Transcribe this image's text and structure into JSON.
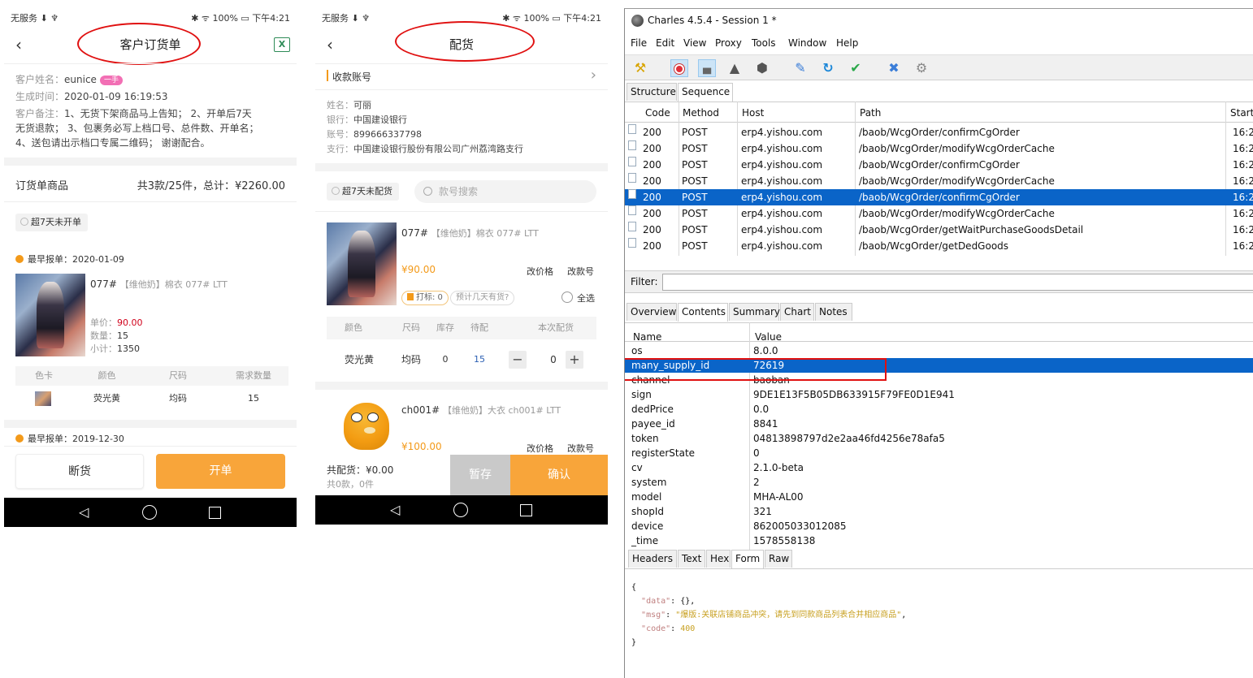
{
  "status": {
    "left": "无服务",
    "battery": "100%",
    "time": "下午4:21"
  },
  "colors": {
    "accent": "#f8a53a",
    "selection": "#0a64c8",
    "annotation": "#e01010"
  },
  "order_page": {
    "title": "客户订货单",
    "customer_label": "客户姓名：",
    "customer_name": "eunice",
    "customer_badge": "一手",
    "time_label": "生成时间：",
    "created_time": "2020-01-09 16:19:53",
    "remark_label": "客户备注：",
    "remark_line1": "1、无货下架商品马上告知； 2、开单后7天",
    "remark_line2": "无货退款； 3、包裹务必写上档口号、总件数、开单名；",
    "remark_line3": "4、送包请出示档口专属二维码； 谢谢配合。",
    "goods_label": "订货单商品",
    "goods_summary": "共3款/25件，总计：¥2260.00",
    "filter_chip": "超7天未开单",
    "earliest_label": "最早报单：",
    "group1_date": "2020-01-09",
    "product": {
      "code": "077#",
      "desc": "【维他奶】棉衣 077# LTT",
      "price_label": "单价：",
      "price": "90.00",
      "qty_label": "数量：",
      "qty": "15",
      "subtotal_label": "小计：",
      "subtotal": "1350"
    },
    "table_headers": [
      "色卡",
      "颜色",
      "尺码",
      "需求数量"
    ],
    "table_row": {
      "color": "荧光黄",
      "size": "均码",
      "qty": "15"
    },
    "group2_date": "2019-12-30",
    "btn_stock_out": "断货",
    "btn_open": "开单"
  },
  "supply_page": {
    "title": "配货",
    "account_label": "收款账号",
    "name_label": "姓名：",
    "name": "可丽",
    "bank_label": "银行：",
    "bank": "中国建设银行",
    "account_no_label": "账号：",
    "account_no": "899666337798",
    "branch_label": "支行：",
    "branch": "中国建设银行股份有限公司广州荔湾路支行",
    "filter_chip": "超7天未配货",
    "search_placeholder": "款号搜索",
    "item1": {
      "code": "077#",
      "desc": "【维他奶】棉衣 077# LTT",
      "price": "¥90.00",
      "edit_price": "改价格",
      "edit_code": "改款号",
      "mark": "打标: 0",
      "expect": "预计几天有货?",
      "select_all": "全选"
    },
    "table_headers": [
      "颜色",
      "尺码",
      "库存",
      "待配",
      "本次配货"
    ],
    "table_row": {
      "color": "荧光黄",
      "size": "均码",
      "stock": "0",
      "pending": "15",
      "qty": "0"
    },
    "item2": {
      "code": "ch001#",
      "desc": "【维他奶】大衣 ch001# LTT",
      "price": "¥100.00",
      "edit_price": "改价格",
      "edit_code": "改款号"
    },
    "footer_total": "共配货：¥0.00",
    "footer_count": "共0款，0件",
    "btn_save": "暂存",
    "btn_confirm": "确认"
  },
  "charles": {
    "title": "Charles 4.5.4 - Session 1 *",
    "menu": [
      "File",
      "Edit",
      "View",
      "Proxy",
      "Tools",
      "Window",
      "Help"
    ],
    "top_tabs": [
      "Structure",
      "Sequence"
    ],
    "columns": [
      "Code",
      "Method",
      "Host",
      "Path",
      "Start"
    ],
    "rows": [
      {
        "code": "200",
        "method": "POST",
        "host": "erp4.yishou.com",
        "path": "/baob/WcgOrder/confirmCgOrder",
        "start": "16:2"
      },
      {
        "code": "200",
        "method": "POST",
        "host": "erp4.yishou.com",
        "path": "/baob/WcgOrder/modifyWcgOrderCache",
        "start": "16:2"
      },
      {
        "code": "200",
        "method": "POST",
        "host": "erp4.yishou.com",
        "path": "/baob/WcgOrder/confirmCgOrder",
        "start": "16:2"
      },
      {
        "code": "200",
        "method": "POST",
        "host": "erp4.yishou.com",
        "path": "/baob/WcgOrder/modifyWcgOrderCache",
        "start": "16:2"
      },
      {
        "code": "200",
        "method": "POST",
        "host": "erp4.yishou.com",
        "path": "/baob/WcgOrder/confirmCgOrder",
        "start": "16:2"
      },
      {
        "code": "200",
        "method": "POST",
        "host": "erp4.yishou.com",
        "path": "/baob/WcgOrder/modifyWcgOrderCache",
        "start": "16:2"
      },
      {
        "code": "200",
        "method": "POST",
        "host": "erp4.yishou.com",
        "path": "/baob/WcgOrder/getWaitPurchaseGoodsDetail",
        "start": "16:2"
      },
      {
        "code": "200",
        "method": "POST",
        "host": "erp4.yishou.com",
        "path": "/baob/WcgOrder/getDedGoods",
        "start": "16:2"
      }
    ],
    "selected_row": 4,
    "filter_label": "Filter:",
    "detail_tabs": [
      "Overview",
      "Contents",
      "Summary",
      "Chart",
      "Notes"
    ],
    "nv_headers": [
      "Name",
      "Value"
    ],
    "nv_rows": [
      {
        "name": "os",
        "value": "8.0.0"
      },
      {
        "name": "many_supply_id",
        "value": "72619"
      },
      {
        "name": "channel",
        "value": "baoban"
      },
      {
        "name": "sign",
        "value": "9DE1E13F5B05DB633915F79FE0D1E941"
      },
      {
        "name": "dedPrice",
        "value": "0.0"
      },
      {
        "name": "payee_id",
        "value": "8841"
      },
      {
        "name": "token",
        "value": "04813898797d2e2aa46fd4256e78afa5"
      },
      {
        "name": "registerState",
        "value": "0"
      },
      {
        "name": "cv",
        "value": "2.1.0-beta"
      },
      {
        "name": "system",
        "value": "2"
      },
      {
        "name": "model",
        "value": "MHA-AL00"
      },
      {
        "name": "shopId",
        "value": "321"
      },
      {
        "name": "device",
        "value": "862005033012085"
      },
      {
        "name": "_time",
        "value": "1578558138"
      }
    ],
    "nv_selected": 1,
    "bottom_tabs": [
      "Headers",
      "Text",
      "Hex",
      "Form",
      "Raw"
    ],
    "json": {
      "open": "{",
      "k_data": "\"data\"",
      "v_data": "{}",
      "k_msg": "\"msg\"",
      "v_msg": "\"爆版:关联店铺商品冲突，请先到同款商品列表合并相应商品\"",
      "k_code": "\"code\"",
      "v_code": "400",
      "close": "}"
    }
  }
}
